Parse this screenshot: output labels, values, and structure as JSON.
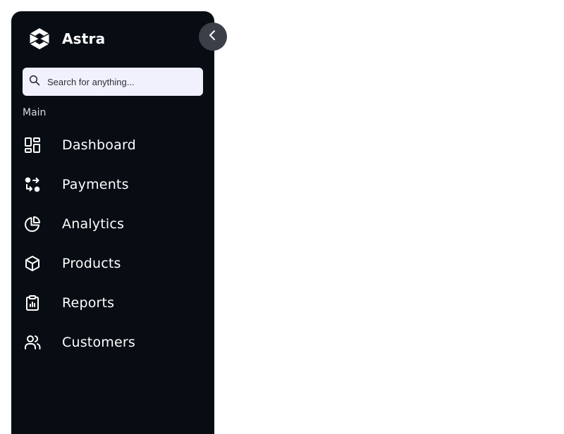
{
  "app": {
    "name": "Astra"
  },
  "sidebar": {
    "search": {
      "placeholder": "Search for anything..."
    },
    "section_label": "Main",
    "items": [
      {
        "label": "Dashboard",
        "icon": "dashboard-grid-icon"
      },
      {
        "label": "Payments",
        "icon": "transfer-icon"
      },
      {
        "label": "Analytics",
        "icon": "pie-chart-icon"
      },
      {
        "label": "Products",
        "icon": "box-icon"
      },
      {
        "label": "Reports",
        "icon": "clipboard-chart-icon"
      },
      {
        "label": "Customers",
        "icon": "users-icon"
      }
    ]
  },
  "colors": {
    "sidebar_bg": "#080d14",
    "search_bg": "#f1f1fd",
    "collapse_button_bg": "#3b4048",
    "text": "#ffffff"
  }
}
